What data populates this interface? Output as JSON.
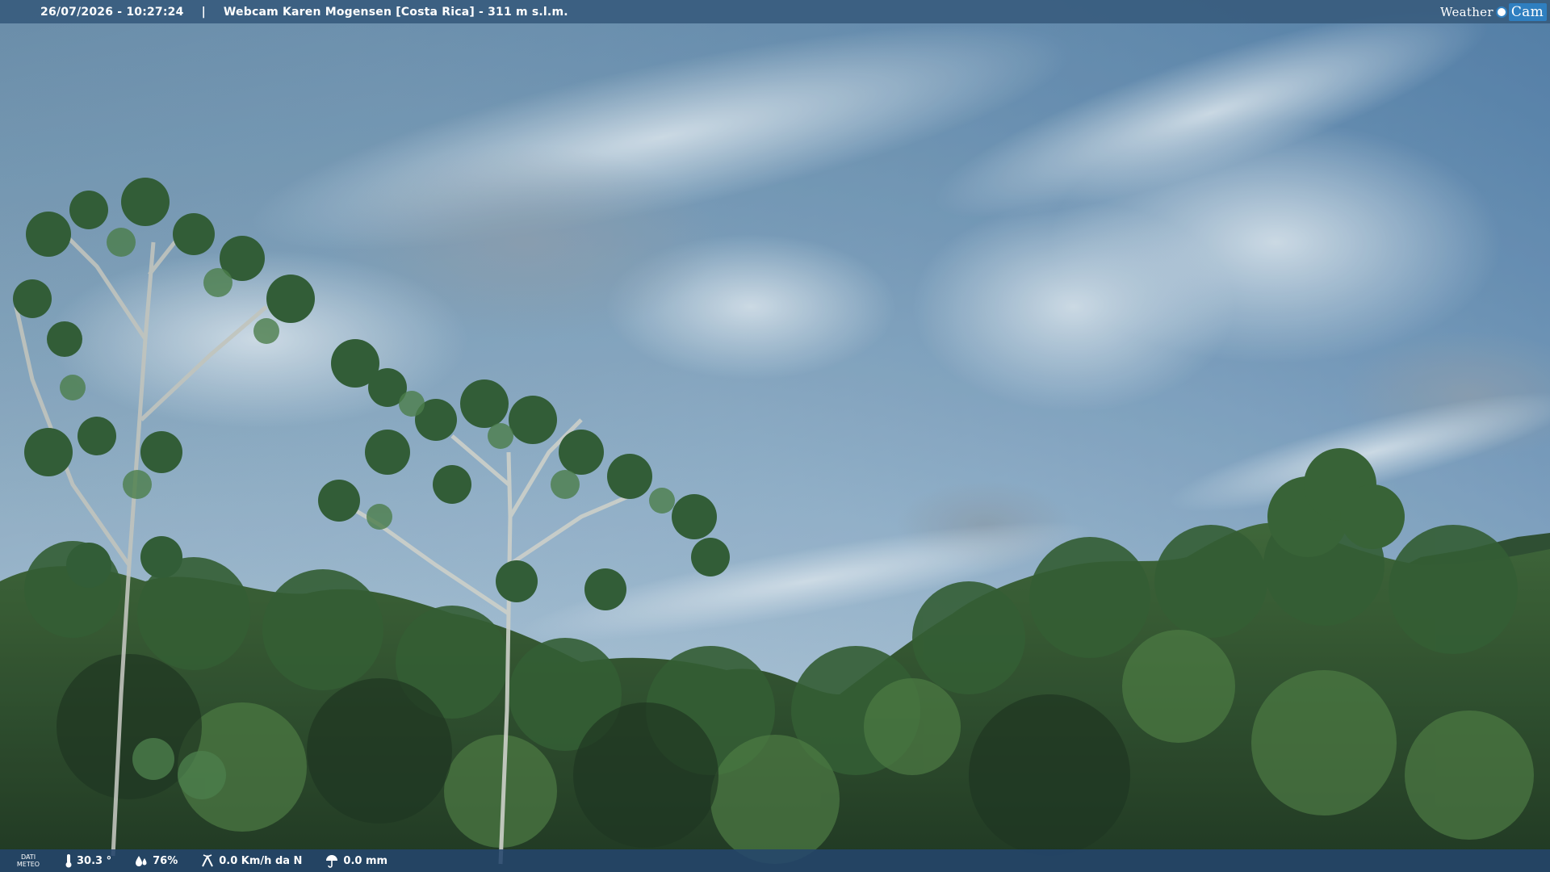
{
  "header": {
    "datetime": "26/07/2026 - 10:27:24",
    "separator": "|",
    "camera_title": "Webcam Karen Mogensen [Costa Rica]  - 311 m s.l.m."
  },
  "brand": {
    "weather": "Weather",
    "cam": "Cam"
  },
  "weather_bar": {
    "label_line1": "DATI",
    "label_line2": "METEO",
    "temperature": "30.3 °",
    "temperature_icon": "thermometer-icon",
    "humidity": "76%",
    "humidity_icon": "humidity-drops-icon",
    "wind": "0.0 Km/h da N",
    "wind_icon": "wind-icon",
    "rain": "0.0 mm",
    "rain_icon": "rain-umbrella-icon"
  },
  "colors": {
    "sky_top": "#5a7f9f",
    "sky_bottom": "#b9cfdf",
    "foliage_dark": "#1f3a1b",
    "foliage_light": "#4f7a3d",
    "bar_accent": "#2f7fc0"
  }
}
